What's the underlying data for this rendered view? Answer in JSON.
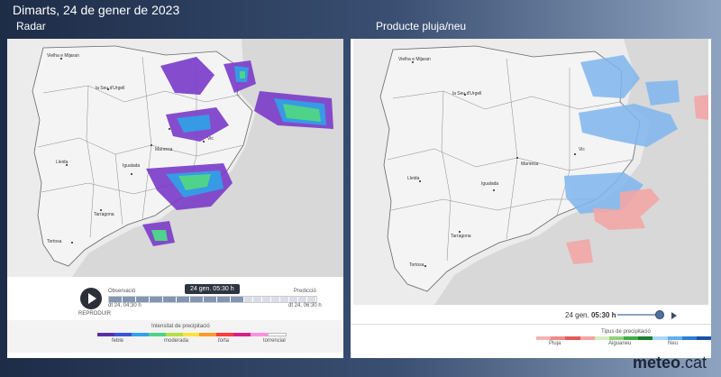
{
  "header": {
    "date": "Dimarts, 24 de gener de 2023",
    "left_title": "Radar",
    "right_title": "Producte pluja/neu"
  },
  "radar": {
    "play_label": "REPRODUIR",
    "observed_label": "Observació",
    "forecast_label": "Predicció",
    "observed_time": "dt 24, 04:30 h",
    "forecast_time": "dt 24, 06:30 h",
    "current_time": "24 gen. 05:30 h",
    "legend_title": "Intensitat de precipitació",
    "legend_labels": [
      "feble",
      "moderada",
      "forta",
      "torrencial"
    ],
    "legend_colors": [
      "#5b2ea8",
      "#3a55d9",
      "#2fa3e8",
      "#4fd28a",
      "#b4e043",
      "#ffe13a",
      "#ff9a2a",
      "#ff3b3b",
      "#d61f8b",
      "#ff8fe0",
      "#ffffff"
    ]
  },
  "product": {
    "time_prefix": "24 gen.",
    "time_value": "05:30 h",
    "legend_title": "Tipus de precipitació",
    "legend_labels": [
      "Pluja",
      "Aiguaneu",
      "Neu"
    ],
    "legend_colors": [
      "#f3b3b3",
      "#ee8a8a",
      "#e25a5a",
      "#f5a3a3",
      "#d3eec0",
      "#8fd27a",
      "#3fae47",
      "#1f7f2e",
      "#a9d7f5",
      "#62aef0",
      "#2e7ed9",
      "#1a4fa8"
    ]
  },
  "map_labels": [
    "Vielha e Mijaran",
    "la Seu d'Urgell",
    "Vic",
    "Manresa",
    "Lleida",
    "Igualada",
    "Tarragona",
    "Tortosa"
  ],
  "brand": {
    "name": "meteo",
    "tld": ".cat"
  }
}
